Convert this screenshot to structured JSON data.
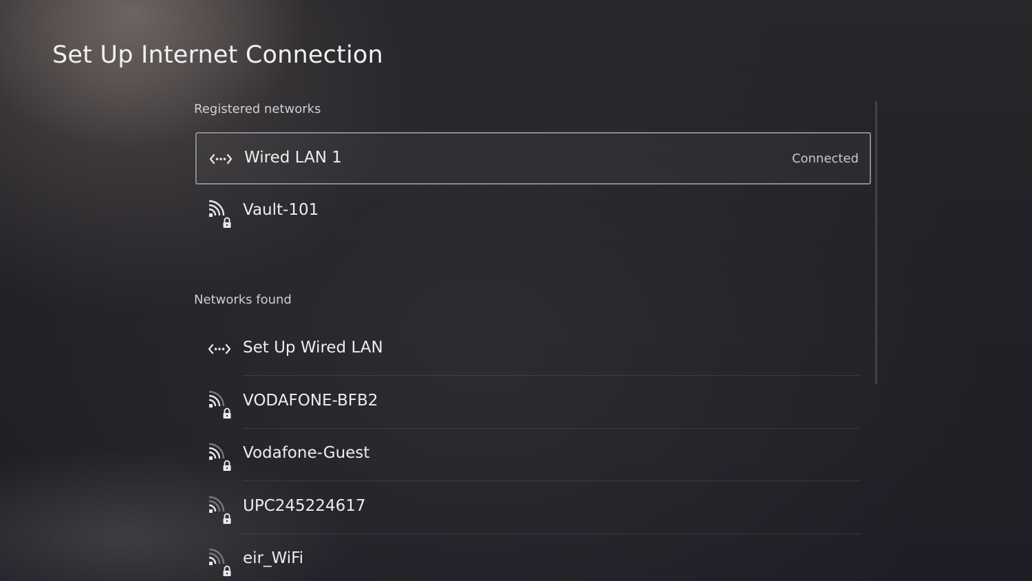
{
  "page": {
    "title": "Set Up Internet Connection"
  },
  "registered": {
    "header": "Registered networks",
    "items": [
      {
        "label": "Wired LAN 1",
        "icon": "wired-lan-icon",
        "status": "Connected",
        "focused": true
      },
      {
        "label": "Vault-101",
        "icon": "wifi-locked-icon",
        "signal": 3
      }
    ]
  },
  "found": {
    "header": "Networks found",
    "items": [
      {
        "label": "Set Up Wired LAN",
        "icon": "wired-lan-icon"
      },
      {
        "label": "VODAFONE-BFB2",
        "icon": "wifi-locked-icon",
        "signal": 2
      },
      {
        "label": "Vodafone-Guest",
        "icon": "wifi-locked-icon",
        "signal": 2
      },
      {
        "label": "UPC245224617",
        "icon": "wifi-locked-icon",
        "signal": 1
      },
      {
        "label": "eir_WiFi",
        "icon": "wifi-locked-icon",
        "signal": 1
      }
    ]
  },
  "colors": {
    "text": "#eeeeef",
    "muted": "#cfcfd3",
    "focus_border": "#8e8e93"
  }
}
